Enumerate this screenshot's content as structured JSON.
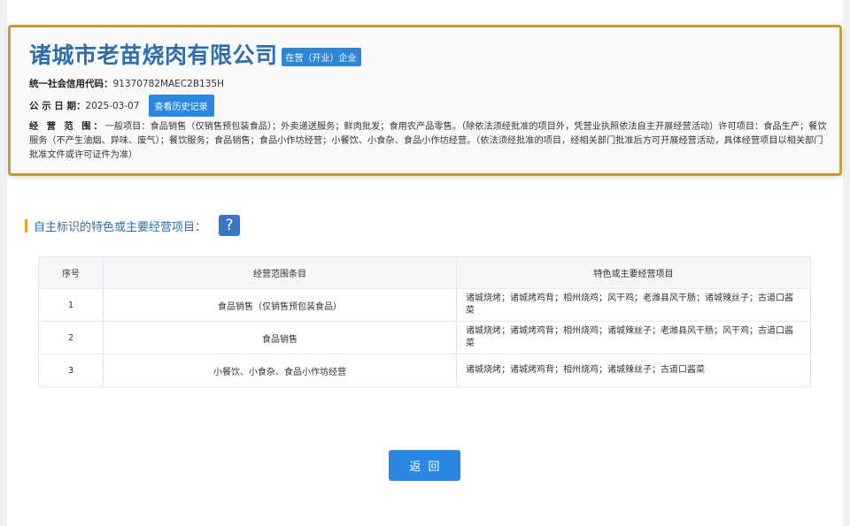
{
  "company": {
    "name": "诸城市老苗烧肉有限公司",
    "status": "在营（开业）企业"
  },
  "credit_code": {
    "label": "统一社会信用代码：",
    "value": "91370782MAEC2B135H"
  },
  "publish_date": {
    "label": "公 示 日 期：",
    "value": "2025-03-07",
    "history_button": "查看历史记录"
  },
  "business_scope": {
    "label": "经 营 范 围：",
    "value": "一般项目：食品销售（仅销售预包装食品）；外卖递送服务；鲜肉批发；食用农产品零售。（除依法须经批准的项目外，凭营业执照依法自主开展经营活动）许可项目：食品生产；餐饮服务（不产生油烟、异味、废气）；餐饮服务；食品销售；食品小作坊经营；小餐饮、小食杂、食品小作坊经营。（依法须经批准的项目，经相关部门批准后方可开展经营活动，具体经营项目以相关部门批准文件或许可证件为准）"
  },
  "section": {
    "title": "自主标识的特色或主要经营项目：",
    "help": "?"
  },
  "table": {
    "headers": [
      "序号",
      "经营范围条目",
      "特色或主要经营项目"
    ],
    "rows": [
      {
        "no": "1",
        "scope": "食品销售（仅销售预包装食品）",
        "features": "诸城烧烤；诸城烤鸡背；相州烧鸡；风干鸡；老潍县风干肠；诸城辣丝子；古道口酱菜"
      },
      {
        "no": "2",
        "scope": "食品销售",
        "features": "诸城烧烤；诸城烤鸡背；相州烧鸡；诸城辣丝子；老潍县风干肠；风干鸡；古道口酱菜"
      },
      {
        "no": "3",
        "scope": "小餐饮、小食杂、食品小作坊经营",
        "features": "诸城烧烤；诸城烤鸡背；相州烧鸡；诸城辣丝子；古道口酱菜"
      }
    ]
  },
  "back_button": "返回",
  "colors": {
    "accent_blue": "#2a88e0",
    "title_blue": "#2f6ea8",
    "card_border": "#c9993a",
    "section_bar": "#f0a020"
  }
}
